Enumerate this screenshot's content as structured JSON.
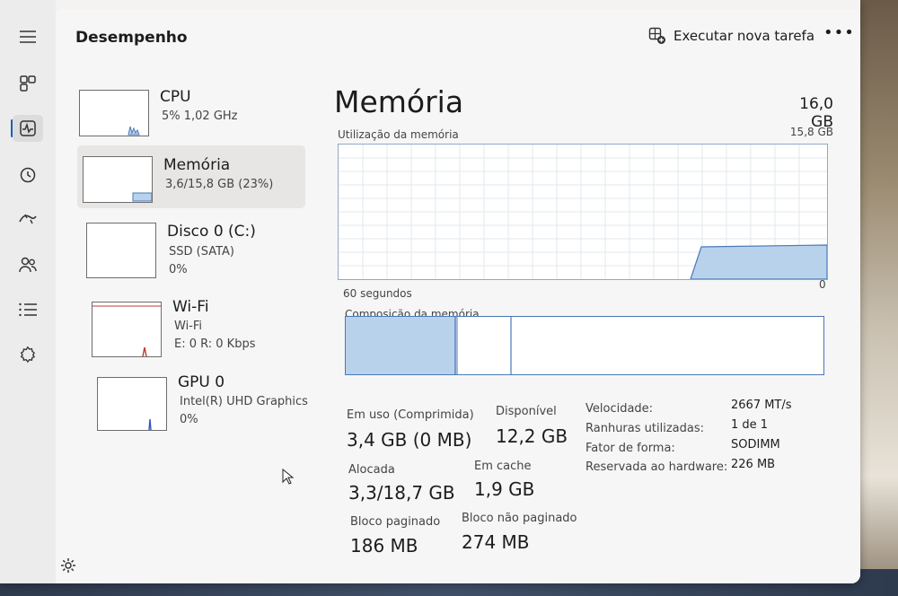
{
  "header": {
    "title": "Desempenho",
    "run_task_label": "Executar nova tarefa",
    "more_label": "•••"
  },
  "devices": [
    {
      "name": "CPU",
      "sub1": "5% 1,02 GHz",
      "sub2": "",
      "sub3": ""
    },
    {
      "name": "Memória",
      "sub1": "3,6/15,8 GB (23%)",
      "sub2": "",
      "sub3": ""
    },
    {
      "name": "Disco 0 (C:)",
      "sub1": "SSD (SATA)",
      "sub2": "0%",
      "sub3": ""
    },
    {
      "name": "Wi-Fi",
      "sub1": "Wi-Fi",
      "sub2": "E: 0 R: 0 Kbps",
      "sub3": ""
    },
    {
      "name": "GPU 0",
      "sub1": "Intel(R) UHD Graphics",
      "sub2": "0%",
      "sub3": ""
    }
  ],
  "memory": {
    "title": "Memória",
    "total": "16,0 GB",
    "usage_label": "Utilização da memória",
    "usage_max": "15,8 GB",
    "time_span": "60 segundos",
    "axis_zero": "0",
    "composition_label": "Composição da memória",
    "in_use_fraction": 0.23,
    "stats": {
      "in_use_label": "Em uso (Comprimida)",
      "in_use_value": "3,4 GB (0 MB)",
      "available_label": "Disponível",
      "available_value": "12,2 GB",
      "committed_label": "Alocada",
      "committed_value": "3,3/18,7 GB",
      "cached_label": "Em cache",
      "cached_value": "1,9 GB",
      "paged_label": "Bloco paginado",
      "paged_value": "186 MB",
      "nonpaged_label": "Bloco não paginado",
      "nonpaged_value": "274 MB"
    },
    "specs": [
      {
        "label": "Velocidade:",
        "value": "2667 MT/s"
      },
      {
        "label": "Ranhuras utilizadas:",
        "value": "1 de 1"
      },
      {
        "label": "Fator de forma:",
        "value": "SODIMM"
      },
      {
        "label": "Reservada ao hardware:",
        "value": "226 MB"
      }
    ]
  },
  "colors": {
    "accent": "#1a5fb4",
    "memory_fill": "#b9d2ec",
    "memory_line": "#4a78b6",
    "wifi_line": "#c0392b",
    "gpu_line": "#3553c4",
    "cpu_line": "#4a78b6"
  }
}
